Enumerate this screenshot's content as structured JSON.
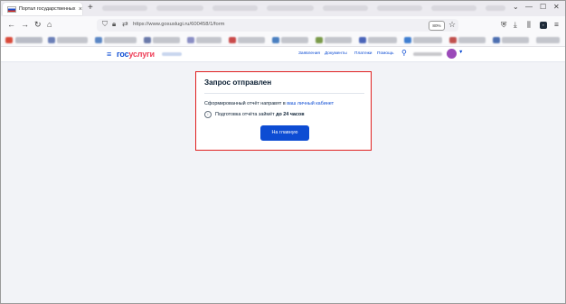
{
  "browser": {
    "tab_title": "Портал государственных усл",
    "tab_close": "×",
    "new_tab": "+",
    "window_controls": [
      "⌄",
      "—",
      "☐",
      "✕"
    ],
    "url": "https://www.gosuslugi.ru/600458/1/form",
    "zoom": "80%"
  },
  "site": {
    "logo_part1": "гос",
    "logo_part2": "услуги",
    "nav": [
      "Заявления",
      "Документы",
      "Платежи",
      "Помощь"
    ]
  },
  "card": {
    "title": "Запрос отправлен",
    "message_prefix": "Сформированный отчёт направят в ",
    "message_link": "ваш личный кабинет",
    "info_prefix": "Подготовка отчёта займёт ",
    "info_bold": "до 24 часов",
    "button_label": "На главную"
  },
  "colors": {
    "brand_blue": "#0d4cd3",
    "brand_red": "#ee3f58",
    "highlight_border": "#e02020"
  }
}
